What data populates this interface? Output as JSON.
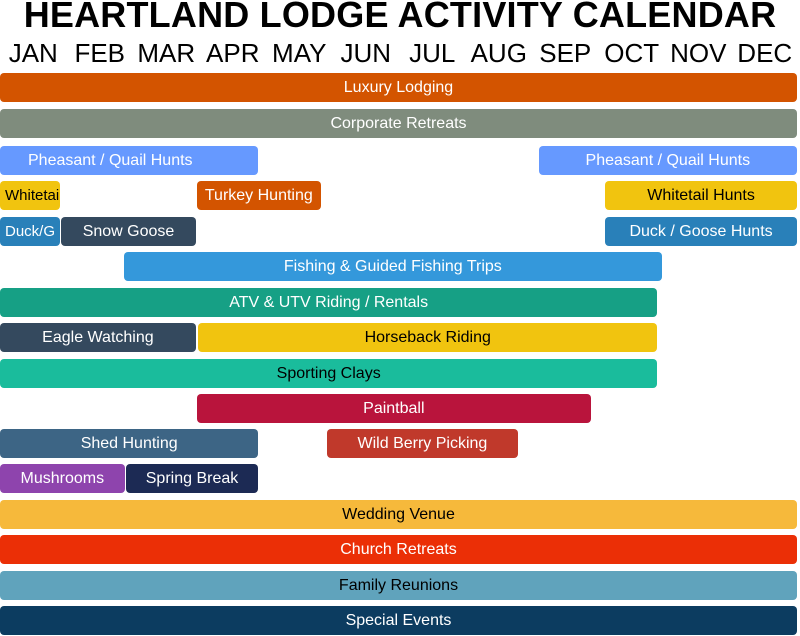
{
  "chart_data": {
    "type": "bar",
    "subtype": "timeline",
    "title": "HEARTLAND LODGE ACTIVITY CALENDAR",
    "categories": [
      "JAN",
      "FEB",
      "MAR",
      "APR",
      "MAY",
      "JUN",
      "JUL",
      "AUG",
      "SEP",
      "OCT",
      "NOV",
      "DEC"
    ],
    "xlim": [
      0,
      12
    ],
    "xlabel": "",
    "ylabel": "",
    "grid": false,
    "rows": [
      {
        "bars": [
          {
            "label": "Luxury Lodging",
            "start": 0,
            "end": 12,
            "color": "#d35400",
            "text_color": "#ffffff"
          }
        ]
      },
      {
        "bars": [
          {
            "label": "Corporate Retreats",
            "start": 0,
            "end": 12,
            "color": "#7f8c7d",
            "text_color": "#ffffff"
          }
        ]
      },
      {
        "bars": [
          {
            "label": "Pheasant / Quail Hunts",
            "start": 0,
            "end": 3.9,
            "color": "#6699ff",
            "text_color": "#ffffff",
            "align": "left-offset"
          },
          {
            "label": "Pheasant / Quail Hunts",
            "start": 8.1,
            "end": 12,
            "color": "#6699ff",
            "text_color": "#ffffff"
          }
        ]
      },
      {
        "bars": [
          {
            "label": "Whitetai",
            "start": 0,
            "end": 0.92,
            "color": "#f1c40f",
            "text_color": "#000000"
          },
          {
            "label": "Turkey Hunting",
            "start": 2.96,
            "end": 4.84,
            "color": "#d35400",
            "text_color": "#ffffff"
          },
          {
            "label": "Whitetail Hunts",
            "start": 9.1,
            "end": 12,
            "color": "#f1c40f",
            "text_color": "#000000"
          }
        ]
      },
      {
        "bars": [
          {
            "label": "Duck/G",
            "start": 0,
            "end": 0.92,
            "color": "#2980b9",
            "text_color": "#ffffff"
          },
          {
            "label": "Snow Goose",
            "start": 0.92,
            "end": 2.96,
            "color": "#34495e",
            "text_color": "#ffffff"
          },
          {
            "label": "Duck / Goose Hunts",
            "start": 9.1,
            "end": 12,
            "color": "#2980b9",
            "text_color": "#ffffff"
          }
        ]
      },
      {
        "bars": [
          {
            "label": "Fishing & Guided Fishing Trips",
            "start": 1.86,
            "end": 9.97,
            "color": "#3498db",
            "text_color": "#ffffff"
          }
        ]
      },
      {
        "bars": [
          {
            "label": "ATV & UTV Riding / Rentals",
            "start": 0,
            "end": 9.9,
            "color": "#16a085",
            "text_color": "#ffffff"
          }
        ]
      },
      {
        "bars": [
          {
            "label": "Eagle Watching",
            "start": 0,
            "end": 2.96,
            "color": "#34495e",
            "text_color": "#ffffff"
          },
          {
            "label": "Horseback Riding",
            "start": 2.98,
            "end": 9.9,
            "color": "#f1c40f",
            "text_color": "#000000"
          }
        ]
      },
      {
        "bars": [
          {
            "label": "Sporting Clays",
            "start": 0,
            "end": 9.9,
            "color": "#1abc9c",
            "text_color": "#000000"
          }
        ]
      },
      {
        "bars": [
          {
            "label": "Paintball",
            "start": 2.96,
            "end": 8.9,
            "color": "#b9143c",
            "text_color": "#ffffff"
          }
        ]
      },
      {
        "bars": [
          {
            "label": "Shed Hunting",
            "start": 0,
            "end": 3.9,
            "color": "#3d6585",
            "text_color": "#ffffff"
          },
          {
            "label": "Wild Berry Picking",
            "start": 4.92,
            "end": 7.8,
            "color": "#c0392b",
            "text_color": "#ffffff"
          }
        ]
      },
      {
        "bars": [
          {
            "label": "Mushrooms",
            "start": 0,
            "end": 1.89,
            "color": "#8e44ad",
            "text_color": "#ffffff"
          },
          {
            "label": "Spring Break",
            "start": 1.89,
            "end": 3.9,
            "color": "#1c2a54",
            "text_color": "#ffffff"
          }
        ]
      },
      {
        "bars": [
          {
            "label": "Wedding Venue",
            "start": 0,
            "end": 12,
            "color": "#f6b93b",
            "text_color": "#000000"
          }
        ]
      },
      {
        "bars": [
          {
            "label": "Church Retreats",
            "start": 0,
            "end": 12,
            "color": "#eb2f06",
            "text_color": "#ffffff"
          }
        ]
      },
      {
        "bars": [
          {
            "label": "Family Reunions",
            "start": 0,
            "end": 12,
            "color": "#60a3bc",
            "text_color": "#000000"
          }
        ]
      },
      {
        "bars": [
          {
            "label": "Special Events",
            "start": 0,
            "end": 12,
            "color": "#0c3c60",
            "text_color": "#ffffff"
          }
        ]
      }
    ]
  }
}
